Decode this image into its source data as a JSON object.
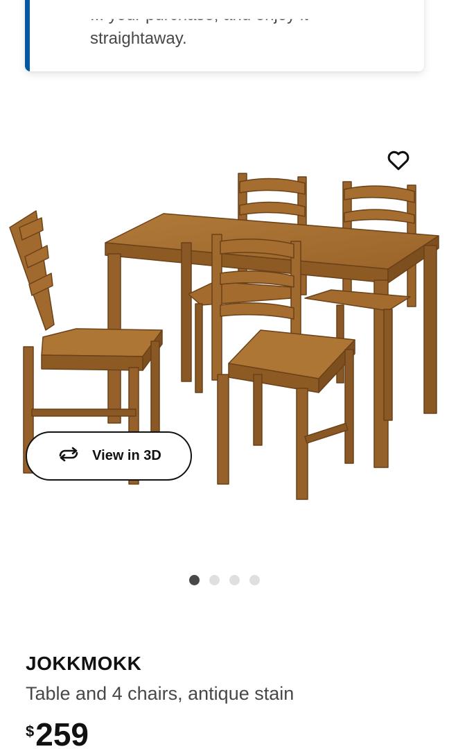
{
  "notice": {
    "clipped_text": "... your purchase, and enjoy it",
    "text": "straightaway."
  },
  "gallery": {
    "favorite_icon": "heart-outline-icon",
    "view_3d_icon": "rotate-3d-icon",
    "view_3d_label": "View in 3D",
    "slides": 4,
    "active_slide": 1
  },
  "product": {
    "name": "JOKKMOKK",
    "description": "Table and 4 chairs, antique stain",
    "price_currency": "$",
    "price_amount": "259"
  },
  "colors": {
    "accent": "#0058a3",
    "wood": "#a0692d",
    "wood_dark": "#7a4c1c",
    "dot_active": "#484848",
    "dot_inactive": "#dfdfdf"
  }
}
